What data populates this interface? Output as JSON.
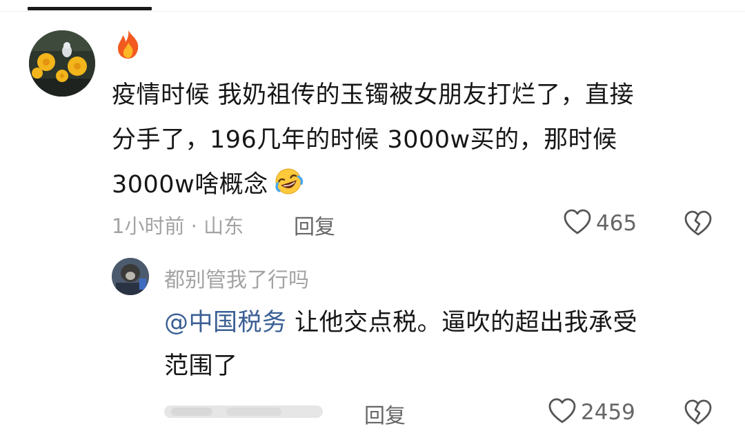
{
  "comment": {
    "lines": [
      "疫情时候 我奶祖传的玉镯被女朋友打烂了，直接",
      "分手了，196几年的时候  3000w买的，那时候",
      "3000w啥概念"
    ],
    "badge_icon": "fire-icon",
    "emoji_icon": "rofl-emoji",
    "meta": "1小时前 · 山东",
    "reply_label": "回复",
    "likes": "465"
  },
  "reply": {
    "username": "都别管我了行吗",
    "mention": "@中国税务",
    "text_line1": " 让他交点税。逼吹的超出我承受",
    "text_line2": "范围了",
    "reply_label": "回复",
    "likes": "2459"
  },
  "colors": {
    "mention": "#3a5f94",
    "meta": "#a3a3a3",
    "text": "#161616"
  }
}
